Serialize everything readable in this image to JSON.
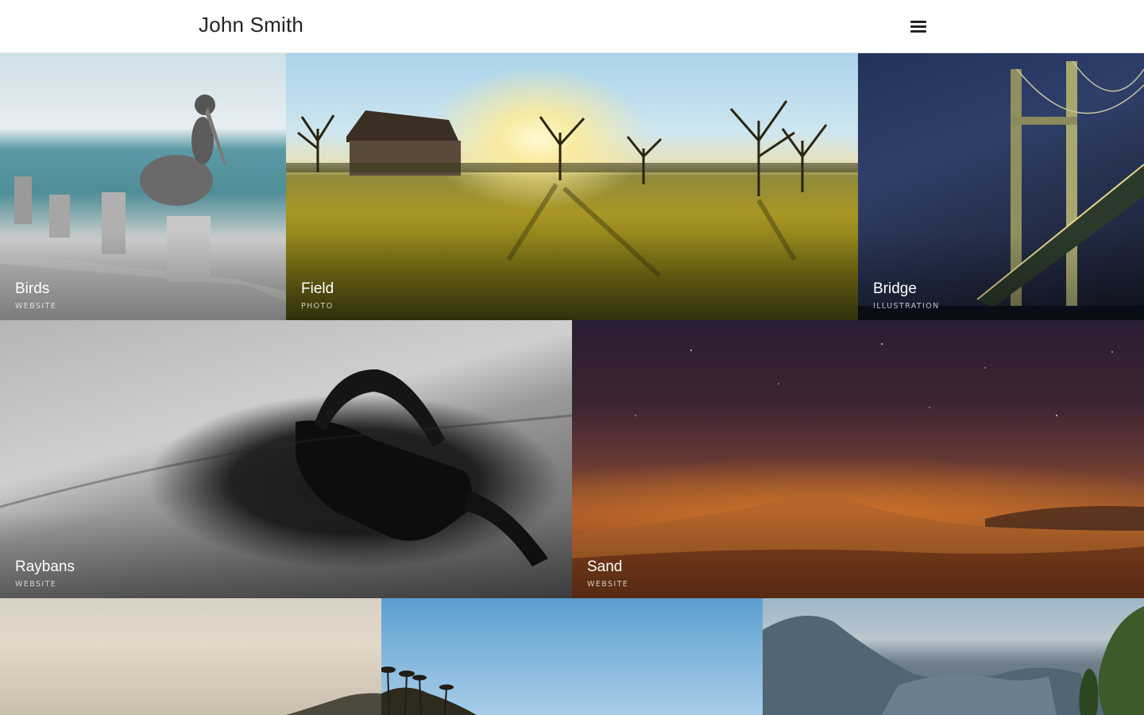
{
  "header": {
    "site_title": "John Smith",
    "menu_icon": "hamburger-icon"
  },
  "portfolio": {
    "items": [
      {
        "title": "Birds",
        "category": "WEBSITE"
      },
      {
        "title": "Field",
        "category": "PHOTO"
      },
      {
        "title": "Bridge",
        "category": "ILLUSTRATION"
      },
      {
        "title": "Raybans",
        "category": "WEBSITE"
      },
      {
        "title": "Sand",
        "category": "WEBSITE"
      }
    ]
  }
}
